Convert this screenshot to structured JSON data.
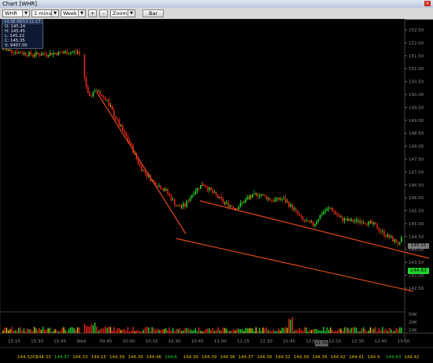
{
  "window": {
    "title": "Chart [WHR]",
    "close_glyph": "×"
  },
  "toolbar": {
    "symbol": "WHR",
    "interval": "1 minute",
    "range": "Week",
    "plus_label": "+",
    "minus_label": "-",
    "zoom": "Zoom",
    "style_label": "Bar",
    "dropdown_arrow": "▼"
  },
  "info_box": {
    "header": "14:38 09/13 11:17",
    "open": "O: 145.24",
    "high": "H: 145.45",
    "low": "L: 145.22",
    "close": "C: 145.35",
    "volume": "V: 9407.00"
  },
  "price_axis": {
    "labels": [
      "152.50",
      "152.00",
      "151.50",
      "151.00",
      "150.50",
      "150.00",
      "149.50",
      "149.00",
      "148.50",
      "148.00",
      "147.50",
      "147.00",
      "146.50",
      "146.00",
      "145.50",
      "145.00",
      "144.50",
      "144.00",
      "143.50",
      "143.00",
      "142.50"
    ]
  },
  "volume_axis": {
    "labels": [
      "50K",
      "20K",
      "10K"
    ]
  },
  "time_axis": {
    "labels": [
      "15:15",
      "15:30",
      "15:45",
      "Wed",
      "09:45",
      "10:00",
      "10:15",
      "10:30",
      "10:45",
      "11:00",
      "11:15",
      "11:30",
      "11:45",
      "12:00",
      "12:15",
      "12:30",
      "12:45",
      "13:00"
    ]
  },
  "time_tooltip": "11:56",
  "badges": {
    "last_price": "144.63",
    "marker_price": "145.16"
  },
  "bottom_prices": {
    "values": [
      "144.3201",
      "144.33",
      "144.37",
      "144.33",
      "144.15",
      "144.39",
      "144.39",
      "144.46",
      "144.6",
      "144.39",
      "144.39",
      "144.36",
      "144.37",
      "144.39",
      "144.32",
      "144.39",
      "144.34",
      "144.42",
      "144.41",
      "144.4",
      "144.43",
      "144.42"
    ],
    "colors": [
      "#e8c000",
      "#e8c000",
      "#1fd42c",
      "#e8c000",
      "#e8c000",
      "#e8c000",
      "#e8c000",
      "#e8c000",
      "#1fd42c",
      "#e8c000",
      "#e8c000",
      "#e8c000",
      "#e8c000",
      "#e8c000",
      "#e8c000",
      "#e8c000",
      "#e8c000",
      "#e8c000",
      "#e8c000",
      "#e8c000",
      "#1fd42c",
      "#e8c000"
    ]
  },
  "colors": {
    "up": "#1fd42c",
    "down": "#e4261a",
    "flat": "#e8c000",
    "trendline": "#e04a1c",
    "background": "#000000"
  }
}
